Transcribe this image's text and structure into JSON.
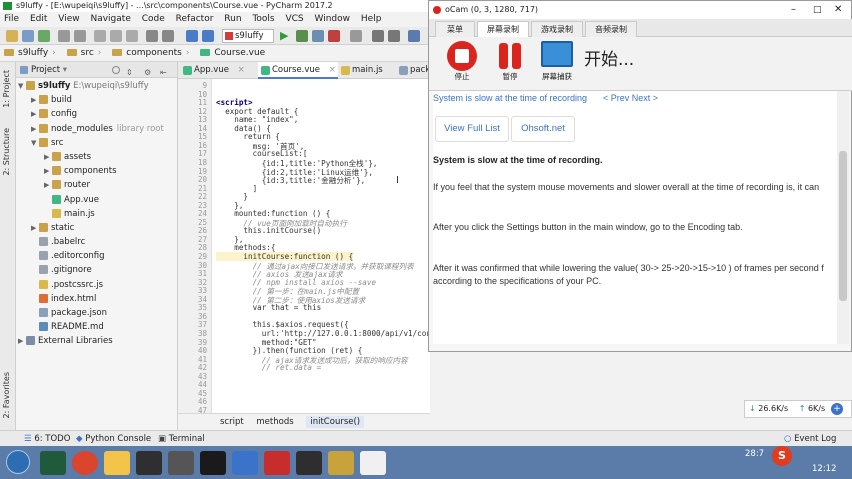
{
  "window": {
    "title": "s9luffy - [E:\\wupeiqi\\s9luffy] - ...\\src\\components\\Course.vue - PyCharm 2017.2"
  },
  "menu": [
    "File",
    "Edit",
    "View",
    "Navigate",
    "Code",
    "Refactor",
    "Run",
    "Tools",
    "VCS",
    "Window",
    "Help"
  ],
  "toolbar": {
    "run_config": "s9luffy"
  },
  "breadcrumb": [
    "s9luffy",
    "src",
    "components",
    "Course.vue"
  ],
  "project_panel": {
    "title": "Project",
    "root": "s9luffy",
    "root_path": "E:\\wupeiqi\\s9luffy",
    "items": [
      {
        "label": "build",
        "type": "folder",
        "indent": 1,
        "arrow": "▶"
      },
      {
        "label": "config",
        "type": "folder",
        "indent": 1,
        "arrow": "▶"
      },
      {
        "label": "node_modules",
        "type": "folder",
        "indent": 1,
        "arrow": "▶",
        "note": "library root"
      },
      {
        "label": "src",
        "type": "folder",
        "indent": 1,
        "arrow": "▼"
      },
      {
        "label": "assets",
        "type": "folder",
        "indent": 2,
        "arrow": "▶"
      },
      {
        "label": "components",
        "type": "folder",
        "indent": 2,
        "arrow": "▶"
      },
      {
        "label": "router",
        "type": "folder",
        "indent": 2,
        "arrow": "▶"
      },
      {
        "label": "App.vue",
        "type": "vue",
        "indent": 2,
        "arrow": ""
      },
      {
        "label": "main.js",
        "type": "js",
        "indent": 2,
        "arrow": ""
      },
      {
        "label": "static",
        "type": "folder",
        "indent": 1,
        "arrow": "▶"
      },
      {
        "label": ".babelrc",
        "type": "file",
        "indent": 1,
        "arrow": ""
      },
      {
        "label": ".editorconfig",
        "type": "file",
        "indent": 1,
        "arrow": ""
      },
      {
        "label": ".gitignore",
        "type": "file",
        "indent": 1,
        "arrow": ""
      },
      {
        "label": ".postcssrc.js",
        "type": "js",
        "indent": 1,
        "arrow": ""
      },
      {
        "label": "index.html",
        "type": "html",
        "indent": 1,
        "arrow": ""
      },
      {
        "label": "package.json",
        "type": "json",
        "indent": 1,
        "arrow": ""
      },
      {
        "label": "README.md",
        "type": "md",
        "indent": 1,
        "arrow": ""
      },
      {
        "label": "External Libraries",
        "type": "lib",
        "indent": 0,
        "arrow": "▶"
      }
    ]
  },
  "left_strip": {
    "project": "1: Project",
    "structure": "2: Structure",
    "favorites": "2: Favorites"
  },
  "editor_tabs": [
    "App.vue",
    "Course.vue",
    "main.js",
    "package"
  ],
  "active_tab": "Course.vue",
  "code": {
    "line_numbers": [
      "9",
      "10",
      "11",
      "12",
      "13",
      "14",
      "15",
      "16",
      "17",
      "18",
      "19",
      "20",
      "21",
      "22",
      "23",
      "24",
      "25",
      "26",
      "27",
      "28",
      "29",
      "30",
      "31",
      "32",
      "33",
      "34",
      "35",
      "36",
      "37",
      "38",
      "39",
      "40",
      "41",
      "42",
      "43",
      "44",
      "45",
      "46",
      "47"
    ],
    "lines": [
      "",
      "<script>",
      "  export default {",
      "    name: \"index\",",
      "    data() {",
      "      return {",
      "        msg: '首页',",
      "        courseList:[",
      "          {id:1,title:'Python全栈'},",
      "          {id:2,title:'Linux运维'},",
      "          {id:3,title:'金融分析'},",
      "        ]",
      "      }",
      "    },",
      "    mounted:function () {",
      "      // vue页面刚加载时自动执行",
      "      this.initCourse()",
      "    },",
      "    methods:{",
      "      initCourse:function () {",
      "        // 通过ajax向接口发送请求，并获取课程列表",
      "        // axios 发送ajax请求",
      "        // npm install axios --save",
      "        // 第一步：在main.js中配置",
      "        // 第二步：使用axios发送请求",
      "        var that = this",
      "",
      "        this.$axios.request({",
      "          url:'http://127.0.0.1:8000/api/v1/course/',",
      "          method:\"GET\"",
      "        }).then(function (ret) {",
      "          // ajax请求发送成功后，获取的响应内容",
      "          // ret.data ="
    ]
  },
  "editor_breadcrumb": [
    "script",
    "methods",
    "initCourse()"
  ],
  "bottom_tools": {
    "todo": "6: TODO",
    "python_console": "Python Console",
    "terminal": "Terminal",
    "event_log": "Event Log"
  },
  "status": {
    "position": "28:7",
    "time": "12:12"
  },
  "network": {
    "down": "26.6K/s",
    "up": "6K/s"
  },
  "ocam": {
    "title": "oCam (0, 3, 1280, 717)",
    "tabs": [
      "菜单",
      "屏幕录制",
      "游戏录制",
      "音频录制"
    ],
    "buttons": {
      "stop": "停止",
      "pause": "暂停",
      "capture": "屏幕捕获"
    },
    "status_text": "开始...",
    "web": {
      "heading_link": "System is slow at the time of recording",
      "nav": "< Prev Next >",
      "btn_full_list": "View Full List",
      "btn_site": "Ohsoft.net",
      "title": "System is slow at the time of recording.",
      "p1": "If you feel that the system mouse movements and slower overall at the time of recording is, it can",
      "p2": "After you click the Settings button in the main window, go to the Encoding tab.",
      "p3a": "After it was confirmed that while lowering the value( 30-> 25->20->15->10 ) of frames per second f",
      "p3b": "according to the specifications of your PC."
    }
  },
  "colors": {
    "accent": "#3a73c9",
    "ocam_record": "#d9251d",
    "taskbar": "#5b7ba8"
  }
}
